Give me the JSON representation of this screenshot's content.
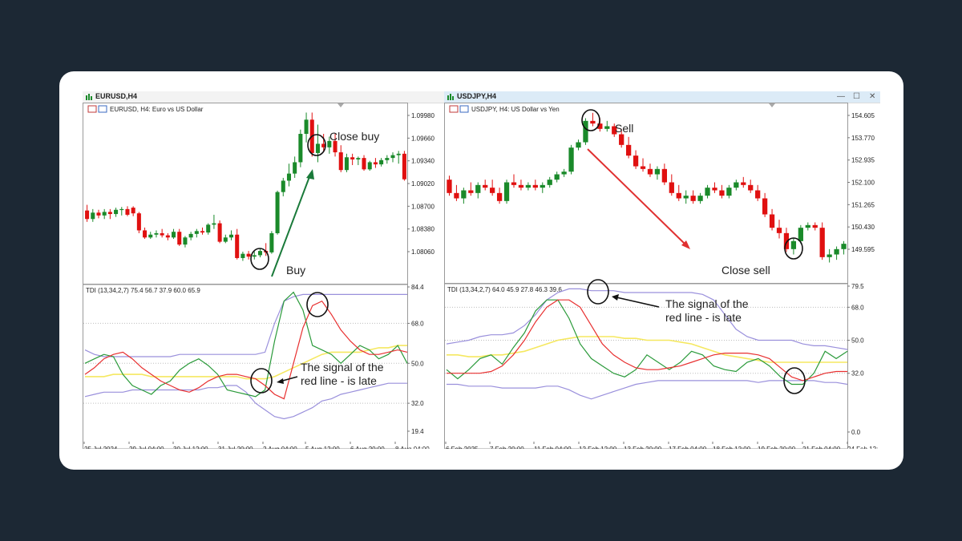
{
  "left_window": {
    "title": "EURUSD,H4",
    "main_label": "EURUSD, H4:  Euro vs US Dollar",
    "indicator_label": "TDI (13,34,2,7) 75.4 56.7 37.9 60.0 65.9",
    "annotations": {
      "close_buy": "Close buy",
      "buy": "Buy",
      "signal": "The signal of the red line - is late"
    },
    "x_labels": [
      "25 Jul 2024",
      "29 Jul 04:00",
      "30 Jul 12:00",
      "31 Jul 20:00",
      "2 Aug 04:00",
      "5 Aug 12:00",
      "6 Aug 20:00",
      "8 Aug 04:00"
    ],
    "price_labels": [
      "1.09980",
      "1.09660",
      "1.09340",
      "1.09020",
      "1.08700",
      "1.08380",
      "1.08060"
    ],
    "indicator_labels": [
      "84.4",
      "68.0",
      "50.0",
      "32.0",
      "19.4"
    ]
  },
  "right_window": {
    "title": "USDJPY,H4",
    "main_label": "USDJPY, H4:  US Dollar vs Yen",
    "indicator_label": "TDI (13,34,2,7) 64.0 45.9 27.8 46.3 39.6",
    "annotations": {
      "sell": "Sell",
      "close_sell": "Close sell",
      "signal": "The signal of the red line - is late"
    },
    "x_labels": [
      "6 Feb 2025",
      "7 Feb 20:00",
      "11 Feb 04:00",
      "12 Feb 12:00",
      "13 Feb 20:00",
      "17 Feb 04:00",
      "18 Feb 12:00",
      "19 Feb 20:00",
      "21 Feb 04:00",
      "24 Feb 12:"
    ],
    "price_labels": [
      "154.605",
      "153.770",
      "152.935",
      "152.100",
      "151.265",
      "150.430",
      "149.595"
    ],
    "indicator_labels": [
      "79.5",
      "68.0",
      "50.0",
      "32.0",
      "0.0"
    ]
  },
  "colors": {
    "bull": "#1a8a2a",
    "bear": "#e01010",
    "red_line": "#e83030",
    "green_line": "#2a9a3a",
    "yellow_line": "#f5e860",
    "band": "#9a90dc",
    "arrow_up": "#1a7a3a",
    "arrow_down": "#e03030"
  },
  "chart_data": [
    {
      "type": "candlestick",
      "symbol": "EURUSD",
      "timeframe": "H4",
      "price_ticks": [
        1.0998,
        1.0966,
        1.0934,
        1.0902,
        1.087,
        1.0838,
        1.0806
      ],
      "candles": [
        [
          1.0864,
          1.0872,
          1.0848,
          1.0852
        ],
        [
          1.0852,
          1.0866,
          1.0848,
          1.0861
        ],
        [
          1.0861,
          1.0865,
          1.0853,
          1.0857
        ],
        [
          1.0857,
          1.0866,
          1.0852,
          1.0862
        ],
        [
          1.0862,
          1.0866,
          1.0852,
          1.0859
        ],
        [
          1.0859,
          1.0868,
          1.0855,
          1.0865
        ],
        [
          1.0865,
          1.0869,
          1.0857,
          1.0866
        ],
        [
          1.0866,
          1.087,
          1.0856,
          1.0858
        ],
        [
          1.0868,
          1.087,
          1.0856,
          1.086
        ],
        [
          1.086,
          1.0862,
          1.0832,
          1.0836
        ],
        [
          1.0836,
          1.084,
          1.0824,
          1.0826
        ],
        [
          1.0826,
          1.0834,
          1.0824,
          1.083
        ],
        [
          1.083,
          1.0836,
          1.0826,
          1.0832
        ],
        [
          1.0832,
          1.0838,
          1.0826,
          1.0829
        ],
        [
          1.0829,
          1.0832,
          1.0822,
          1.0826
        ],
        [
          1.0826,
          1.0838,
          1.0824,
          1.0834
        ],
        [
          1.0834,
          1.0838,
          1.0814,
          1.0816
        ],
        [
          1.0816,
          1.0828,
          1.0812,
          1.0826
        ],
        [
          1.0826,
          1.0834,
          1.0822,
          1.0831
        ],
        [
          1.0831,
          1.0838,
          1.0826,
          1.0835
        ],
        [
          1.0835,
          1.084,
          1.083,
          1.0833
        ],
        [
          1.0833,
          1.0846,
          1.083,
          1.0844
        ],
        [
          1.0844,
          1.0858,
          1.0838,
          1.0846
        ],
        [
          1.0846,
          1.085,
          1.0818,
          1.082
        ],
        [
          1.082,
          1.083,
          1.0818,
          1.0826
        ],
        [
          1.0826,
          1.0836,
          1.0822,
          1.083
        ],
        [
          1.083,
          1.0838,
          1.0795,
          1.0797
        ],
        [
          1.0797,
          1.0806,
          1.0793,
          1.0803
        ],
        [
          1.0803,
          1.0807,
          1.0795,
          1.0799
        ],
        [
          1.0799,
          1.0806,
          1.0795,
          1.0801
        ],
        [
          1.0801,
          1.081,
          1.0798,
          1.0807
        ],
        [
          1.0807,
          1.0818,
          1.08,
          1.0805
        ],
        [
          1.0805,
          1.0835,
          1.0803,
          1.0832
        ],
        [
          1.0832,
          1.0892,
          1.083,
          1.089
        ],
        [
          1.089,
          1.091,
          1.0884,
          1.0906
        ],
        [
          1.0906,
          1.093,
          1.0898,
          1.0916
        ],
        [
          1.0916,
          1.094,
          1.091,
          1.0932
        ],
        [
          1.0932,
          1.0978,
          1.0925,
          1.0972
        ],
        [
          1.0972,
          1.1002,
          1.096,
          1.0992
        ],
        [
          1.0992,
          1.1002,
          1.094,
          1.0945
        ],
        [
          1.0945,
          1.0985,
          1.0932,
          1.0958
        ],
        [
          1.0958,
          1.0972,
          1.0946,
          1.0953
        ],
        [
          1.0953,
          1.0968,
          1.0944,
          1.0962
        ],
        [
          1.0962,
          1.0972,
          1.094,
          1.0946
        ],
        [
          1.0946,
          1.0956,
          1.0918,
          1.0921
        ],
        [
          1.0921,
          1.0944,
          1.0918,
          1.0939
        ],
        [
          1.0939,
          1.0944,
          1.0928,
          1.0936
        ],
        [
          1.0936,
          1.094,
          1.0928,
          1.0938
        ],
        [
          1.0938,
          1.0942,
          1.092,
          1.0922
        ],
        [
          1.0922,
          1.0934,
          1.092,
          1.0932
        ],
        [
          1.0932,
          1.0938,
          1.0924,
          1.0929
        ],
        [
          1.0929,
          1.0938,
          1.0926,
          1.0935
        ],
        [
          1.0935,
          1.0942,
          1.093,
          1.0938
        ],
        [
          1.0938,
          1.0946,
          1.0932,
          1.0942
        ],
        [
          1.0942,
          1.0948,
          1.093,
          1.0944
        ],
        [
          1.0944,
          1.0948,
          1.0906,
          1.0908
        ]
      ],
      "indicator": {
        "name": "TDI (13,34,2,7)",
        "ticks": [
          84.4,
          68.0,
          50.0,
          32.0,
          19.4
        ],
        "ylim": [
          19.4,
          84.4
        ],
        "red": [
          45,
          48,
          52,
          54,
          55,
          52,
          48,
          45,
          42,
          40,
          38,
          37,
          39,
          42,
          44,
          45,
          45,
          44,
          43,
          40,
          36,
          34,
          50,
          66,
          76,
          78,
          72,
          65,
          60,
          56,
          54,
          54,
          55,
          56,
          55
        ],
        "green": [
          50,
          52,
          54,
          53,
          45,
          40,
          38,
          36,
          40,
          42,
          47,
          50,
          52,
          49,
          45,
          38,
          37,
          36,
          35,
          38,
          60,
          78,
          82,
          74,
          58,
          56,
          54,
          50,
          54,
          58,
          56,
          52,
          54,
          58,
          50
        ],
        "yellow": [
          44,
          44,
          44,
          45,
          45,
          45,
          45,
          44,
          44,
          44,
          44,
          44,
          44,
          44,
          44,
          44,
          44,
          43,
          43,
          43,
          44,
          46,
          48,
          50,
          52,
          54,
          55,
          55,
          55,
          55,
          56,
          57,
          57,
          58,
          58
        ],
        "upper_band": [
          56,
          54,
          53,
          53,
          53,
          53,
          53,
          53,
          53,
          53,
          54,
          54,
          54,
          54,
          54,
          54,
          54,
          54,
          54,
          55,
          68,
          78,
          80,
          81,
          81,
          81,
          81,
          81,
          81,
          81,
          81,
          81,
          81,
          81,
          81
        ],
        "lower_band": [
          35,
          36,
          37,
          37,
          37,
          38,
          38,
          38,
          38,
          38,
          38,
          38,
          38,
          39,
          39,
          40,
          40,
          37,
          32,
          29,
          26,
          25,
          26,
          28,
          30,
          33,
          34,
          36,
          37,
          38,
          39,
          40,
          41,
          41,
          41
        ]
      }
    },
    {
      "type": "candlestick",
      "symbol": "USDJPY",
      "timeframe": "H4",
      "price_ticks": [
        154.605,
        153.77,
        152.935,
        152.1,
        151.265,
        150.43,
        149.595
      ],
      "candles": [
        [
          152.2,
          152.35,
          151.6,
          151.7
        ],
        [
          151.7,
          152.0,
          151.4,
          151.5
        ],
        [
          151.5,
          151.9,
          151.3,
          151.8
        ],
        [
          151.8,
          152.1,
          151.6,
          151.7
        ],
        [
          151.7,
          152.1,
          151.5,
          152.0
        ],
        [
          152.0,
          152.2,
          151.8,
          151.9
        ],
        [
          151.9,
          152.2,
          151.6,
          151.7
        ],
        [
          151.7,
          151.9,
          151.3,
          151.4
        ],
        [
          151.4,
          152.2,
          151.3,
          152.1
        ],
        [
          152.1,
          152.4,
          151.9,
          152.0
        ],
        [
          152.0,
          152.2,
          151.8,
          151.9
        ],
        [
          151.9,
          152.1,
          151.8,
          152.0
        ],
        [
          152.0,
          152.2,
          151.8,
          151.9
        ],
        [
          151.9,
          152.1,
          151.7,
          152.0
        ],
        [
          152.0,
          152.3,
          151.9,
          152.2
        ],
        [
          152.2,
          152.5,
          152.1,
          152.4
        ],
        [
          152.4,
          152.6,
          152.3,
          152.5
        ],
        [
          152.5,
          153.5,
          152.4,
          153.4
        ],
        [
          153.4,
          153.7,
          153.3,
          153.6
        ],
        [
          153.6,
          154.5,
          153.5,
          154.4
        ],
        [
          154.4,
          154.7,
          154.2,
          154.3
        ],
        [
          154.3,
          154.5,
          154.0,
          154.1
        ],
        [
          154.1,
          154.4,
          154.0,
          154.2
        ],
        [
          154.2,
          154.3,
          153.8,
          153.9
        ],
        [
          153.9,
          154.1,
          153.4,
          153.5
        ],
        [
          153.5,
          153.8,
          153.0,
          153.1
        ],
        [
          153.1,
          153.3,
          152.6,
          152.7
        ],
        [
          152.7,
          153.0,
          152.5,
          152.6
        ],
        [
          152.6,
          152.8,
          152.3,
          152.4
        ],
        [
          152.4,
          152.7,
          152.2,
          152.6
        ],
        [
          152.6,
          152.8,
          152.0,
          152.1
        ],
        [
          152.1,
          152.4,
          151.6,
          151.7
        ],
        [
          151.7,
          152.0,
          151.4,
          151.5
        ],
        [
          151.5,
          151.8,
          151.3,
          151.6
        ],
        [
          151.6,
          151.8,
          151.3,
          151.4
        ],
        [
          151.4,
          151.7,
          151.3,
          151.6
        ],
        [
          151.6,
          152.0,
          151.5,
          151.9
        ],
        [
          151.9,
          152.1,
          151.7,
          151.8
        ],
        [
          151.8,
          152.0,
          151.5,
          151.6
        ],
        [
          151.6,
          152.0,
          151.5,
          151.9
        ],
        [
          151.9,
          152.2,
          151.8,
          152.1
        ],
        [
          152.1,
          152.3,
          151.9,
          152.0
        ],
        [
          152.0,
          152.2,
          151.7,
          151.8
        ],
        [
          151.8,
          152.0,
          151.4,
          151.5
        ],
        [
          151.5,
          151.7,
          150.8,
          150.9
        ],
        [
          150.9,
          151.1,
          150.3,
          150.4
        ],
        [
          150.4,
          150.7,
          150.0,
          150.2
        ],
        [
          150.2,
          150.4,
          149.5,
          149.6
        ],
        [
          149.6,
          150.0,
          149.4,
          149.9
        ],
        [
          149.9,
          150.5,
          149.8,
          150.4
        ],
        [
          150.4,
          150.6,
          150.3,
          150.5
        ],
        [
          150.5,
          150.6,
          150.3,
          150.4
        ],
        [
          150.4,
          150.6,
          149.2,
          149.3
        ],
        [
          149.3,
          149.6,
          149.1,
          149.4
        ],
        [
          149.4,
          149.7,
          149.2,
          149.6
        ],
        [
          149.6,
          149.9,
          149.4,
          149.8
        ]
      ],
      "indicator": {
        "name": "TDI (13,34,2,7)",
        "ticks": [
          79.5,
          68.0,
          50.0,
          32.0,
          0.0
        ],
        "ylim": [
          0,
          79.5
        ],
        "red": [
          32,
          32,
          32,
          32,
          33,
          36,
          42,
          50,
          60,
          68,
          72,
          72,
          68,
          58,
          48,
          42,
          38,
          35,
          34,
          34,
          35,
          36,
          38,
          40,
          42,
          43,
          43,
          43,
          42,
          40,
          35,
          30,
          28,
          30,
          32,
          33,
          33
        ],
        "green": [
          34,
          29,
          34,
          40,
          42,
          37,
          46,
          54,
          66,
          72,
          72,
          62,
          48,
          40,
          36,
          32,
          30,
          34,
          42,
          38,
          34,
          38,
          44,
          42,
          36,
          34,
          33,
          38,
          40,
          36,
          30,
          26,
          26,
          32,
          44,
          40,
          44
        ],
        "yellow": [
          42,
          42,
          41,
          41,
          42,
          42,
          43,
          44,
          46,
          48,
          50,
          51,
          52,
          52,
          52,
          52,
          51,
          51,
          50,
          50,
          50,
          49,
          48,
          46,
          44,
          42,
          41,
          40,
          39,
          38,
          38,
          38,
          38,
          38,
          38,
          38,
          38
        ],
        "upper_band": [
          48,
          49,
          50,
          52,
          53,
          53,
          54,
          58,
          64,
          72,
          76,
          78,
          78,
          77,
          77,
          77,
          76,
          76,
          76,
          76,
          76,
          76,
          76,
          75,
          72,
          64,
          56,
          52,
          50,
          50,
          50,
          50,
          48,
          47,
          47,
          46,
          45
        ],
        "lower_band": [
          26,
          26,
          25,
          25,
          25,
          24,
          24,
          24,
          24,
          25,
          25,
          23,
          20,
          18,
          20,
          22,
          24,
          26,
          27,
          28,
          28,
          28,
          28,
          28,
          28,
          28,
          28,
          28,
          27,
          28,
          28,
          28,
          28,
          28,
          27,
          27,
          26
        ]
      }
    }
  ]
}
